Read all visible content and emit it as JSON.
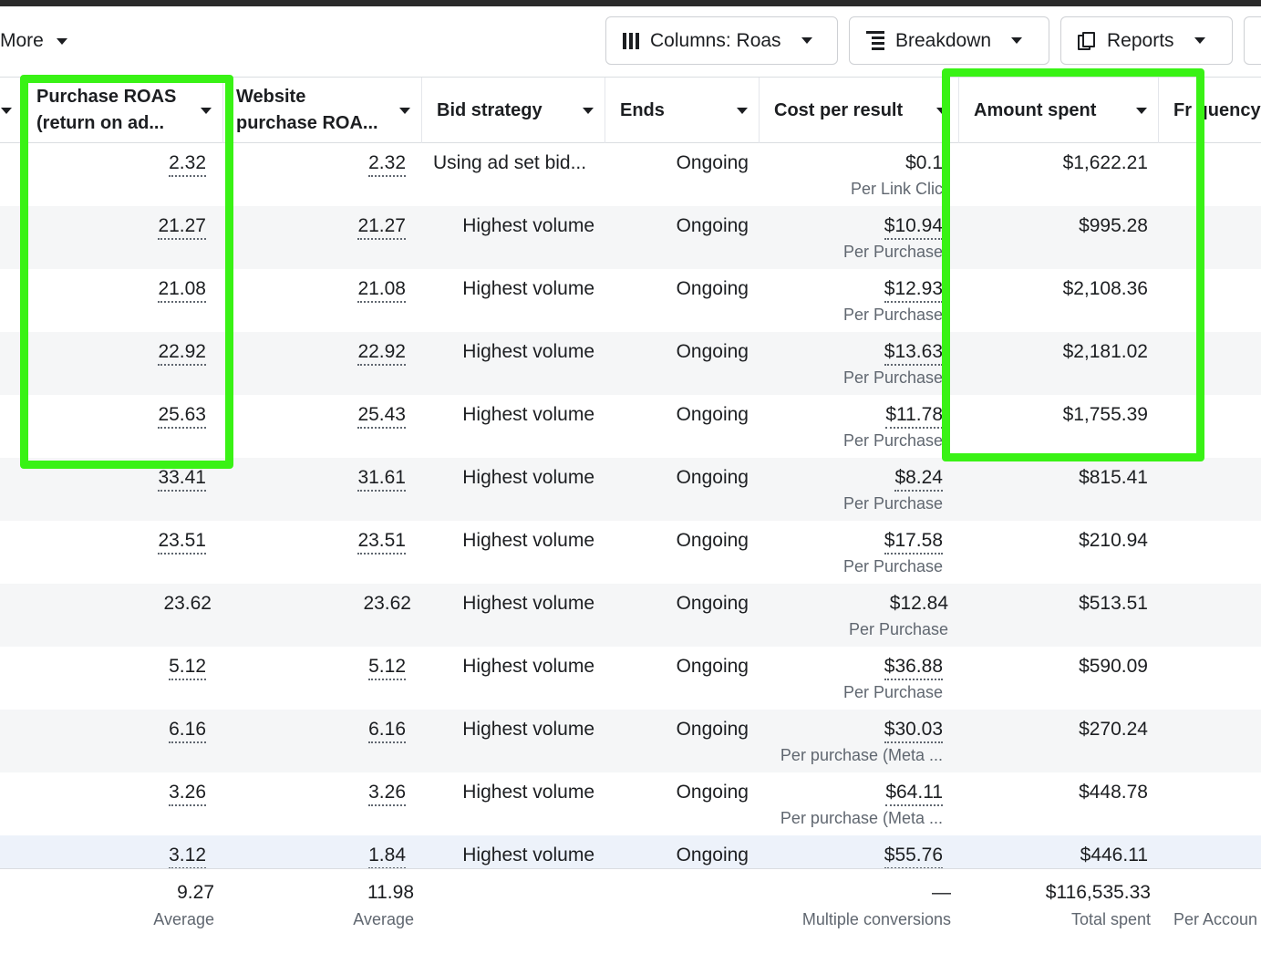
{
  "toolbar": {
    "more_label": "More",
    "columns_label": "Columns: Roas",
    "breakdown_label": "Breakdown",
    "reports_label": "Reports"
  },
  "columns": [
    {
      "label": "Purchase ROAS (return on ad..."
    },
    {
      "label": "Website purchase ROA..."
    },
    {
      "label": "Bid strategy"
    },
    {
      "label": "Ends"
    },
    {
      "label": "Cost per result"
    },
    {
      "label": "Amount spent"
    },
    {
      "label": "Frequency"
    }
  ],
  "header_lines": {
    "purchase_roas_1": "Purchase ROAS",
    "purchase_roas_2": "(return on ad...",
    "website_roas_1": "Website",
    "website_roas_2": "purchase ROA...",
    "frequency_partial": "Fr quency"
  },
  "rows": [
    {
      "purchase_roas": "2.32",
      "website_roas": "2.32",
      "bid_strategy": "Using ad set bid...",
      "ends": "Ongoing",
      "cost_per_result": "$0.1",
      "cost_label": "Per Link Clic",
      "amount_spent": "$1,622.21"
    },
    {
      "purchase_roas": "21.27",
      "website_roas": "21.27",
      "bid_strategy": "Highest volume",
      "ends": "Ongoing",
      "cost_per_result": "$10.94",
      "cost_label": "Per Purchase",
      "amount_spent": "$995.28"
    },
    {
      "purchase_roas": "21.08",
      "website_roas": "21.08",
      "bid_strategy": "Highest volume",
      "ends": "Ongoing",
      "cost_per_result": "$12.93",
      "cost_label": "Per Purchase",
      "amount_spent": "$2,108.36"
    },
    {
      "purchase_roas": "22.92",
      "website_roas": "22.92",
      "bid_strategy": "Highest volume",
      "ends": "Ongoing",
      "cost_per_result": "$13.63",
      "cost_label": "Per Purchase",
      "amount_spent": "$2,181.02"
    },
    {
      "purchase_roas": "25.63",
      "website_roas": "25.43",
      "bid_strategy": "Highest volume",
      "ends": "Ongoing",
      "cost_per_result": "$11.78",
      "cost_label": "Per Purchase",
      "amount_spent": "$1,755.39"
    },
    {
      "purchase_roas": "33.41",
      "website_roas": "31.61",
      "bid_strategy": "Highest volume",
      "ends": "Ongoing",
      "cost_per_result": "$8.24",
      "cost_label": "Per Purchase",
      "amount_spent": "$815.41"
    },
    {
      "purchase_roas": "23.51",
      "website_roas": "23.51",
      "bid_strategy": "Highest volume",
      "ends": "Ongoing",
      "cost_per_result": "$17.58",
      "cost_label": "Per Purchase",
      "amount_spent": "$210.94"
    },
    {
      "purchase_roas": "23.62",
      "website_roas": "23.62",
      "bid_strategy": "Highest volume",
      "ends": "Ongoing",
      "cost_per_result": "$12.84",
      "cost_label": "Per Purchase",
      "amount_spent": "$513.51"
    },
    {
      "purchase_roas": "5.12",
      "website_roas": "5.12",
      "bid_strategy": "Highest volume",
      "ends": "Ongoing",
      "cost_per_result": "$36.88",
      "cost_label": "Per Purchase",
      "amount_spent": "$590.09"
    },
    {
      "purchase_roas": "6.16",
      "website_roas": "6.16",
      "bid_strategy": "Highest volume",
      "ends": "Ongoing",
      "cost_per_result": "$30.03",
      "cost_label": "Per purchase (Meta ...",
      "amount_spent": "$270.24"
    },
    {
      "purchase_roas": "3.26",
      "website_roas": "3.26",
      "bid_strategy": "Highest volume",
      "ends": "Ongoing",
      "cost_per_result": "$64.11",
      "cost_label": "Per purchase (Meta ...",
      "amount_spent": "$448.78"
    },
    {
      "purchase_roas": "3.12",
      "website_roas": "1.84",
      "bid_strategy": "Highest volume",
      "ends": "Ongoing",
      "cost_per_result": "$55.76",
      "cost_label": "",
      "amount_spent": "$446.11"
    }
  ],
  "footer": {
    "purchase_roas_value": "9.27",
    "purchase_roas_label": "Average",
    "website_roas_value": "11.98",
    "website_roas_label": "Average",
    "cost_value": "—",
    "cost_label": "Multiple conversions",
    "amount_value": "$116,535.33",
    "amount_label": "Total spent",
    "frequency_label": "Per Accoun"
  },
  "colors": {
    "highlight": "#39f215",
    "text": "#1c1e21",
    "muted": "#606770",
    "alt_row": "#f5f6f7",
    "selected_row": "#edf2fa"
  }
}
